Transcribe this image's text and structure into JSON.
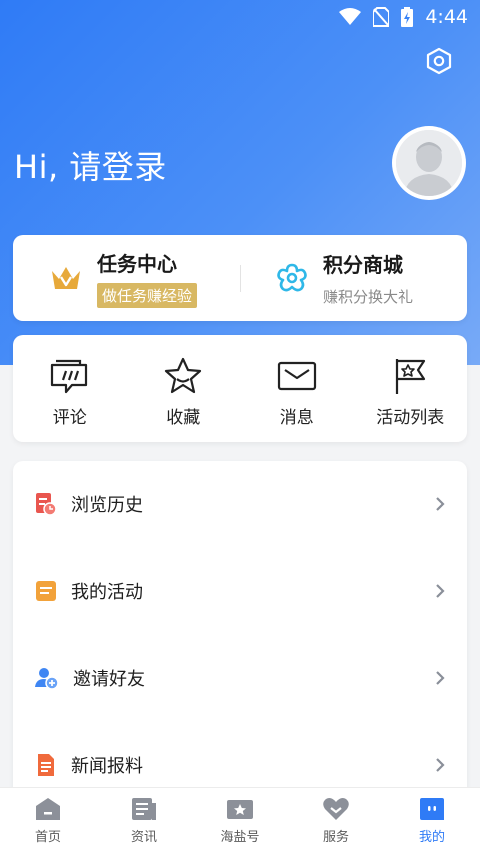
{
  "status_bar": {
    "time": "4:44"
  },
  "header": {
    "greeting": "Hi, 请登录"
  },
  "top_card": {
    "task": {
      "title": "任务中心",
      "badge": "做任务赚经验"
    },
    "points": {
      "title": "积分商城",
      "subtitle": "赚积分换大礼"
    }
  },
  "quick_actions": [
    {
      "label": "评论",
      "icon": "comment-icon"
    },
    {
      "label": "收藏",
      "icon": "star-icon"
    },
    {
      "label": "消息",
      "icon": "mail-icon"
    },
    {
      "label": "活动列表",
      "icon": "flag-icon"
    }
  ],
  "menu": [
    {
      "label": "浏览历史",
      "icon": "history-icon",
      "color": "#e9564f"
    },
    {
      "label": "我的活动",
      "icon": "activity-icon",
      "color": "#f2a23a"
    },
    {
      "label": "邀请好友",
      "icon": "invite-friend-icon",
      "color": "#3f86f3"
    },
    {
      "label": "新闻报料",
      "icon": "news-tip-icon",
      "color": "#f06a3c"
    }
  ],
  "tabbar": [
    {
      "label": "首页",
      "icon": "home-icon"
    },
    {
      "label": "资讯",
      "icon": "news-icon"
    },
    {
      "label": "海盐号",
      "icon": "haiyan-icon"
    },
    {
      "label": "服务",
      "icon": "service-heart-icon"
    },
    {
      "label": "我的",
      "icon": "profile-icon",
      "active": true
    }
  ],
  "colors": {
    "accent": "#2f7bf6",
    "badge_gold": "#d8b863",
    "crown": "#e7a93a",
    "flower": "#2fb8e8"
  }
}
